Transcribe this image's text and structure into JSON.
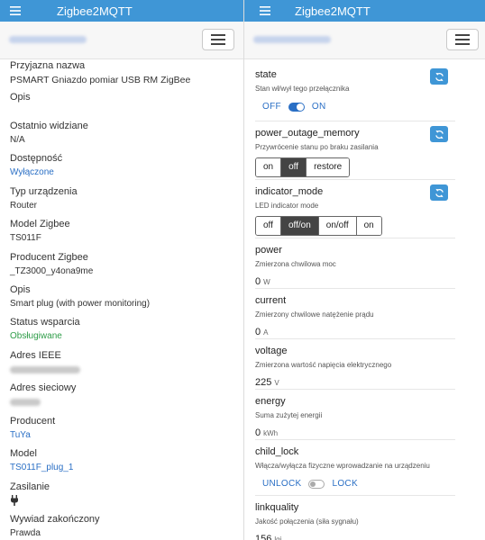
{
  "app": {
    "title": "Zigbee2MQTT"
  },
  "colors": {
    "header": "#3f96d6",
    "link": "#2a6fc5",
    "supported": "#2e9d48",
    "active_button": "#444444"
  },
  "icons": {
    "menu": "hamburger-menu-icon",
    "refresh": "refresh-icon",
    "power_source": "plug-icon"
  },
  "attributes": {
    "friendly_name": {
      "label": "Przyjazna nazwa",
      "value": "PSMART Gniazdo pomiar USB RM ZigBee"
    },
    "description": {
      "label": "Opis"
    },
    "last_seen": {
      "label": "Ostatnio widziane",
      "value": "N/A"
    },
    "availability": {
      "label": "Dostępność",
      "value": "Wyłączone"
    },
    "device_type": {
      "label": "Typ urządzenia",
      "value": "Router"
    },
    "zigbee_model": {
      "label": "Model Zigbee",
      "value": "TS011F"
    },
    "zigbee_manufacturer": {
      "label": "Producent Zigbee",
      "value": "_TZ3000_y4ona9me"
    },
    "description2": {
      "label": "Opis",
      "value": "Smart plug (with power monitoring)"
    },
    "support_status": {
      "label": "Status wsparcia",
      "value": "Obsługiwane"
    },
    "ieee_address": {
      "label": "Adres IEEE"
    },
    "network_address": {
      "label": "Adres sieciowy"
    },
    "manufacturer": {
      "label": "Producent",
      "value": "TuYa"
    },
    "model": {
      "label": "Model",
      "value": "TS011F_plug_1"
    },
    "power_source": {
      "label": "Zasilanie"
    },
    "interview_completed": {
      "label": "Wywiad zakończony",
      "value": "Prawda"
    }
  },
  "features": {
    "state": {
      "name": "state",
      "desc": "Stan wł/wył tego przełącznika",
      "off_label": "OFF",
      "on_label": "ON",
      "value": "ON"
    },
    "power_outage_memory": {
      "name": "power_outage_memory",
      "desc": "Przywrócenie stanu po braku zasilania",
      "options": [
        "on",
        "off",
        "restore"
      ],
      "selected": "off"
    },
    "indicator_mode": {
      "name": "indicator_mode",
      "desc": "LED indicator mode",
      "options": [
        "off",
        "off/on",
        "on/off",
        "on"
      ],
      "selected": "off/on"
    },
    "power": {
      "name": "power",
      "desc": "Zmierzona chwilowa moc",
      "value": "0",
      "unit": "W"
    },
    "current": {
      "name": "current",
      "desc": "Zmierzony chwilowe natężenie prądu",
      "value": "0",
      "unit": "A"
    },
    "voltage": {
      "name": "voltage",
      "desc": "Zmierzona wartość napięcia elektrycznego",
      "value": "225",
      "unit": "V"
    },
    "energy": {
      "name": "energy",
      "desc": "Suma zużytej energii",
      "value": "0",
      "unit": "kWh"
    },
    "child_lock": {
      "name": "child_lock",
      "desc": "Włącza/wyłącza fizyczne wprowadzanie na urządzeniu",
      "off_label": "UNLOCK",
      "on_label": "LOCK",
      "value": "UNLOCK"
    },
    "linkquality": {
      "name": "linkquality",
      "desc": "Jakość połączenia (siła sygnału)",
      "value": "156",
      "unit": "lqi"
    }
  }
}
